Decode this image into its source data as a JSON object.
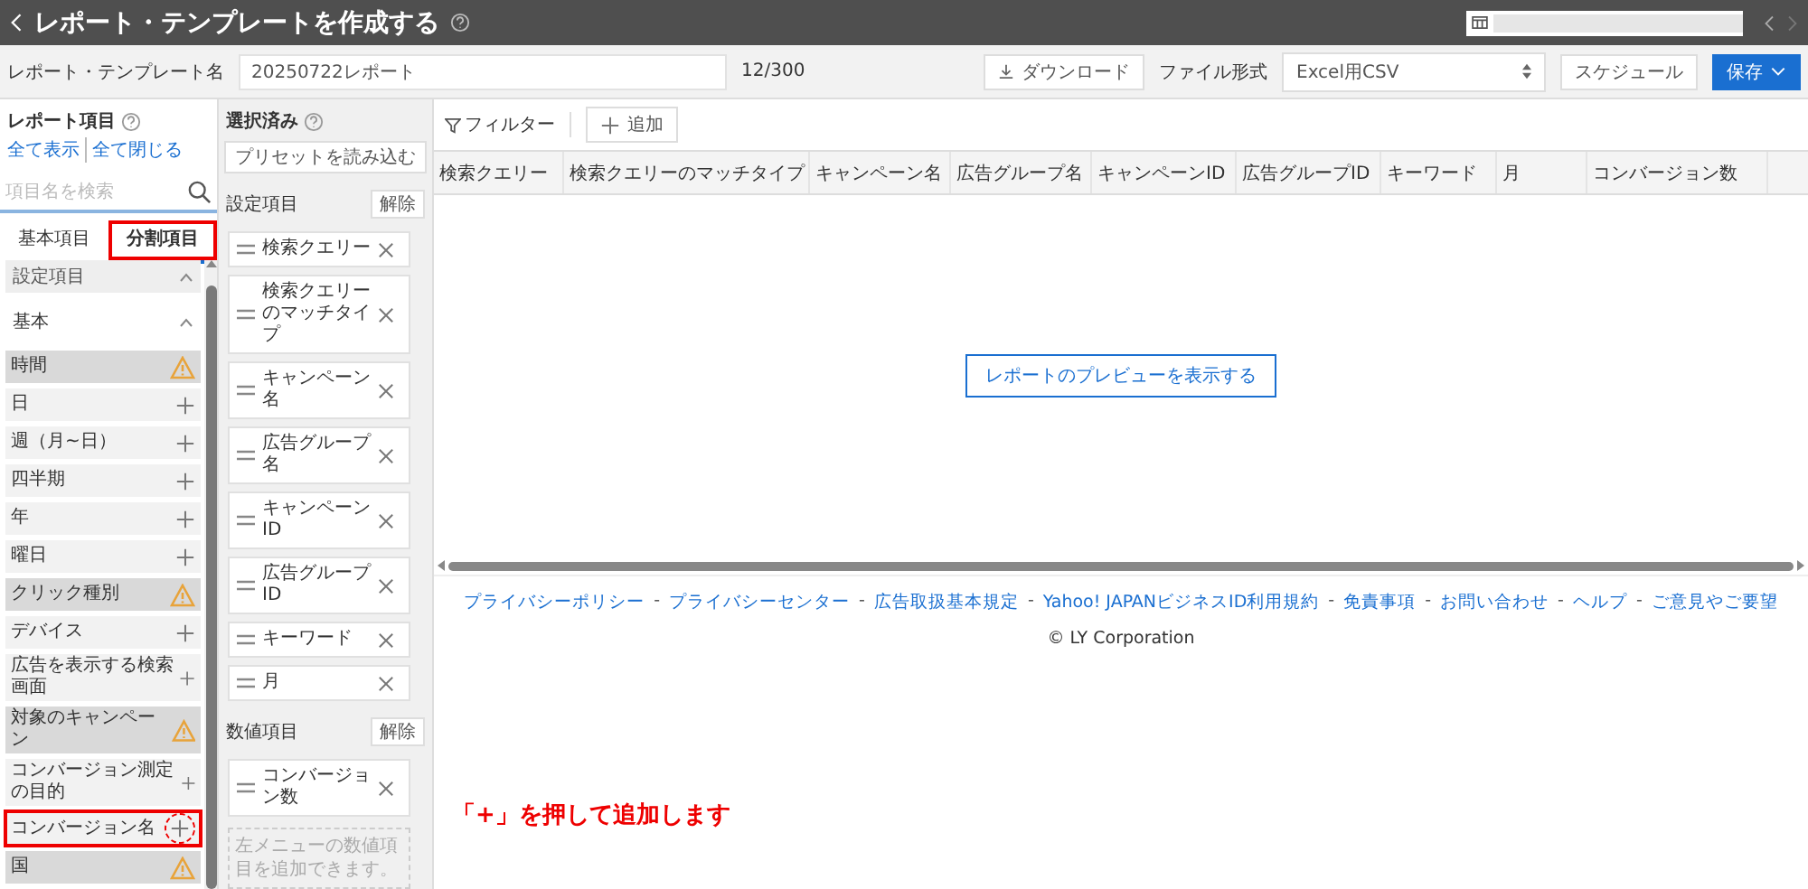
{
  "header": {
    "title": "レポート・テンプレートを作成する"
  },
  "name_row": {
    "label": "レポート・テンプレート名",
    "value": "20250722レポート",
    "counter": "12/300",
    "download": "ダウンロード",
    "format_label": "ファイル形式",
    "format_value": "Excel用CSV",
    "schedule": "スケジュール",
    "save": "保存"
  },
  "report_items": {
    "title": "レポート項目",
    "show_all": "全て表示",
    "close_all": "全て閉じる",
    "search_placeholder": "項目名を検索",
    "tabs": [
      {
        "label": "基本項目",
        "selected": false,
        "highlighted": false
      },
      {
        "label": "分割項目",
        "selected": true,
        "highlighted": true
      }
    ],
    "group": "設定項目",
    "subgroup": "基本",
    "items": [
      {
        "label": "時間",
        "kind": "warning",
        "highlighted": false
      },
      {
        "label": "日",
        "kind": "add",
        "highlighted": false
      },
      {
        "label": "週（月~日）",
        "kind": "add",
        "highlighted": false
      },
      {
        "label": "四半期",
        "kind": "add",
        "highlighted": false
      },
      {
        "label": "年",
        "kind": "add",
        "highlighted": false
      },
      {
        "label": "曜日",
        "kind": "add",
        "highlighted": false
      },
      {
        "label": "クリック種別",
        "kind": "warning",
        "highlighted": false
      },
      {
        "label": "デバイス",
        "kind": "add",
        "highlighted": false
      },
      {
        "label": "広告を表示する検索画面",
        "kind": "add",
        "highlighted": false
      },
      {
        "label": "対象のキャンペーン",
        "kind": "warning",
        "highlighted": false
      },
      {
        "label": "コンバージョン測定の目的",
        "kind": "add",
        "highlighted": false
      },
      {
        "label": "コンバージョン名",
        "kind": "add",
        "highlighted": true
      },
      {
        "label": "国",
        "kind": "warning",
        "highlighted": false
      }
    ]
  },
  "selected": {
    "title": "選択済み",
    "preset": "プリセットを読み込む",
    "settings_label": "設定項目",
    "settings_clear": "解除",
    "settings": [
      "検索クエリー",
      "検索クエリーのマッチタイプ",
      "キャンペーン名",
      "広告グループ名",
      "キャンペーンID",
      "広告グループID",
      "キーワード",
      "月"
    ],
    "metrics_label": "数値項目",
    "metrics_clear": "解除",
    "metrics": [
      "コンバージョン数"
    ],
    "metrics_hint": "左メニューの数値項目を追加できます。"
  },
  "preview": {
    "filter": "フィルター",
    "add": "追加",
    "columns": [
      "検索クエリー",
      "検索クエリーのマッチタイプ",
      "キャンペーン名",
      "広告グループ名",
      "キャンペーンID",
      "広告グループID",
      "キーワード",
      "月",
      "コンバージョン数"
    ],
    "preview_button": "レポートのプレビューを表示する"
  },
  "footer": {
    "links": [
      "プライバシーポリシー",
      "プライバシーセンター",
      "広告取扱基本規定",
      "Yahoo! JAPANビジネスID利用規約",
      "免責事項",
      "お問い合わせ",
      "ヘルプ",
      "ご意見やご要望"
    ],
    "separator": "-",
    "copyright": "© LY Corporation"
  },
  "annotation": {
    "text": "「+」を押して追加します"
  }
}
